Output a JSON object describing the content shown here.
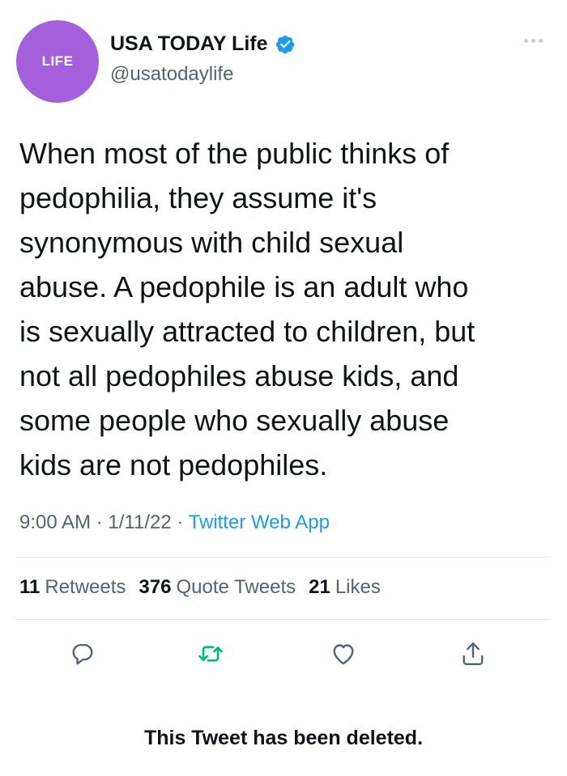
{
  "profile": {
    "avatar_text": "LIFE",
    "avatar_color": "#a460dc",
    "name": "USA TODAY Life",
    "handle": "@usatodaylife",
    "verified": true
  },
  "tweet": {
    "text": "When most of the public thinks of\npedophilia, they assume it's\nsynonymous with child sexual\nabuse. A pedophile is an adult who\nis sexually attracted to children, but\nnot all pedophiles abuse kids, and\nsome people who sexually abuse\nkids are not pedophiles.",
    "time": "9:00 AM",
    "date": "1/11/22",
    "separator": "·",
    "source": "Twitter Web App"
  },
  "stats": {
    "retweets_count": "11",
    "retweets_label": "Retweets",
    "quotes_count": "376",
    "quotes_label": "Quote Tweets",
    "likes_count": "21",
    "likes_label": "Likes"
  },
  "actions": {
    "icons": [
      "reply-icon",
      "retweet-icon",
      "like-icon",
      "share-icon"
    ],
    "retweet_color": "#00ba7c",
    "icon_color": "#536471"
  },
  "notice": "This Tweet has been deleted."
}
